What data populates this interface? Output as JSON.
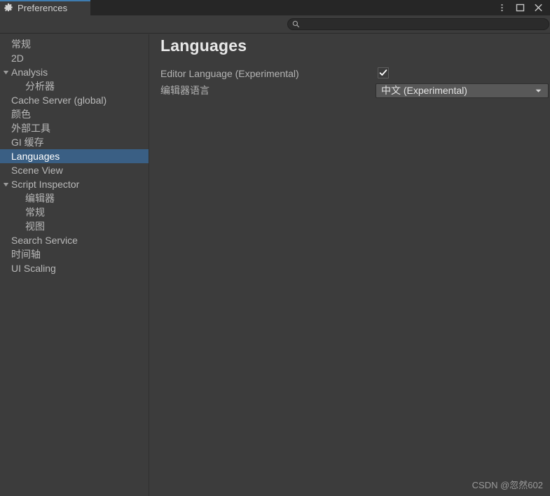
{
  "window": {
    "tab_label": "Preferences",
    "gear_icon": "gear-icon",
    "controls": [
      {
        "name": "more-menu-icon",
        "label": "⋮"
      },
      {
        "name": "maximize-icon",
        "label": "□"
      },
      {
        "name": "close-icon",
        "label": "✕"
      }
    ]
  },
  "search": {
    "icon": "search-icon",
    "value": "",
    "placeholder": ""
  },
  "sidebar": {
    "items": [
      {
        "label": "常规",
        "depth": 0,
        "foldout": false,
        "selected": false
      },
      {
        "label": "2D",
        "depth": 0,
        "foldout": false,
        "selected": false
      },
      {
        "label": "Analysis",
        "depth": 0,
        "foldout": true,
        "selected": false
      },
      {
        "label": "分析器",
        "depth": 1,
        "foldout": false,
        "selected": false
      },
      {
        "label": "Cache Server (global)",
        "depth": 0,
        "foldout": false,
        "selected": false
      },
      {
        "label": "颜色",
        "depth": 0,
        "foldout": false,
        "selected": false
      },
      {
        "label": "外部工具",
        "depth": 0,
        "foldout": false,
        "selected": false
      },
      {
        "label": "GI 缓存",
        "depth": 0,
        "foldout": false,
        "selected": false
      },
      {
        "label": "Languages",
        "depth": 0,
        "foldout": false,
        "selected": true
      },
      {
        "label": "Scene View",
        "depth": 0,
        "foldout": false,
        "selected": false
      },
      {
        "label": "Script Inspector",
        "depth": 0,
        "foldout": true,
        "selected": false
      },
      {
        "label": "编辑器",
        "depth": 1,
        "foldout": false,
        "selected": false
      },
      {
        "label": "常规",
        "depth": 1,
        "foldout": false,
        "selected": false
      },
      {
        "label": "视图",
        "depth": 1,
        "foldout": false,
        "selected": false
      },
      {
        "label": "Search Service",
        "depth": 0,
        "foldout": false,
        "selected": false
      },
      {
        "label": "时间轴",
        "depth": 0,
        "foldout": false,
        "selected": false
      },
      {
        "label": "UI Scaling",
        "depth": 0,
        "foldout": false,
        "selected": false
      }
    ]
  },
  "main": {
    "title": "Languages",
    "editor_language_label": "Editor Language (Experimental)",
    "editor_language_checked": true,
    "editor_language_cn_label": "编辑器语言",
    "language_value": "中文 (Experimental)",
    "language_options": [
      "中文 (Experimental)"
    ]
  },
  "watermark": "CSDN @忽然602",
  "colors": {
    "window_bg": "#3c3c3c",
    "tabbar_bg": "#262626",
    "accent_tab_line": "#3e7cb0",
    "selection": "#3a5f84",
    "label_text": "#b4b4b4",
    "dropdown_bg": "#585858",
    "search_bg": "#2b2b2b"
  }
}
